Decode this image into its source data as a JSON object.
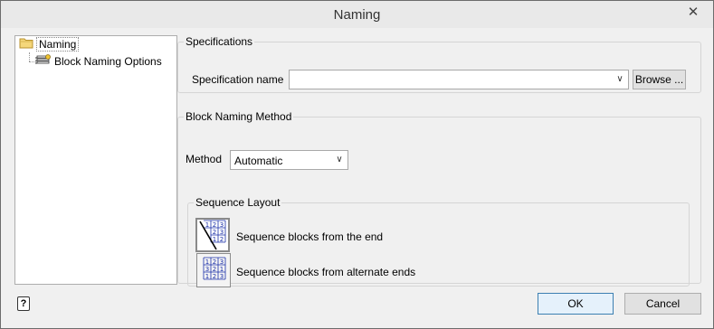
{
  "window": {
    "title": "Naming",
    "close_glyph": "✕"
  },
  "tree": {
    "root": {
      "label": "Naming",
      "icon": "folder-icon"
    },
    "children": [
      {
        "label": "Block Naming Options",
        "icon": "options-icon"
      }
    ]
  },
  "specifications": {
    "legend": "Specifications",
    "name_label": "Specification name",
    "name_value": "",
    "browse_label": "Browse ..."
  },
  "block_naming_method": {
    "legend": "Block Naming Method",
    "method_label": "Method",
    "method_value": "Automatic"
  },
  "sequence_layout": {
    "legend": "Sequence Layout",
    "options": [
      {
        "label": "Sequence blocks from the end",
        "selected": true
      },
      {
        "label": "Sequence blocks from alternate ends",
        "selected": false
      }
    ]
  },
  "footer": {
    "help_glyph": "?",
    "ok_label": "OK",
    "cancel_label": "Cancel"
  }
}
